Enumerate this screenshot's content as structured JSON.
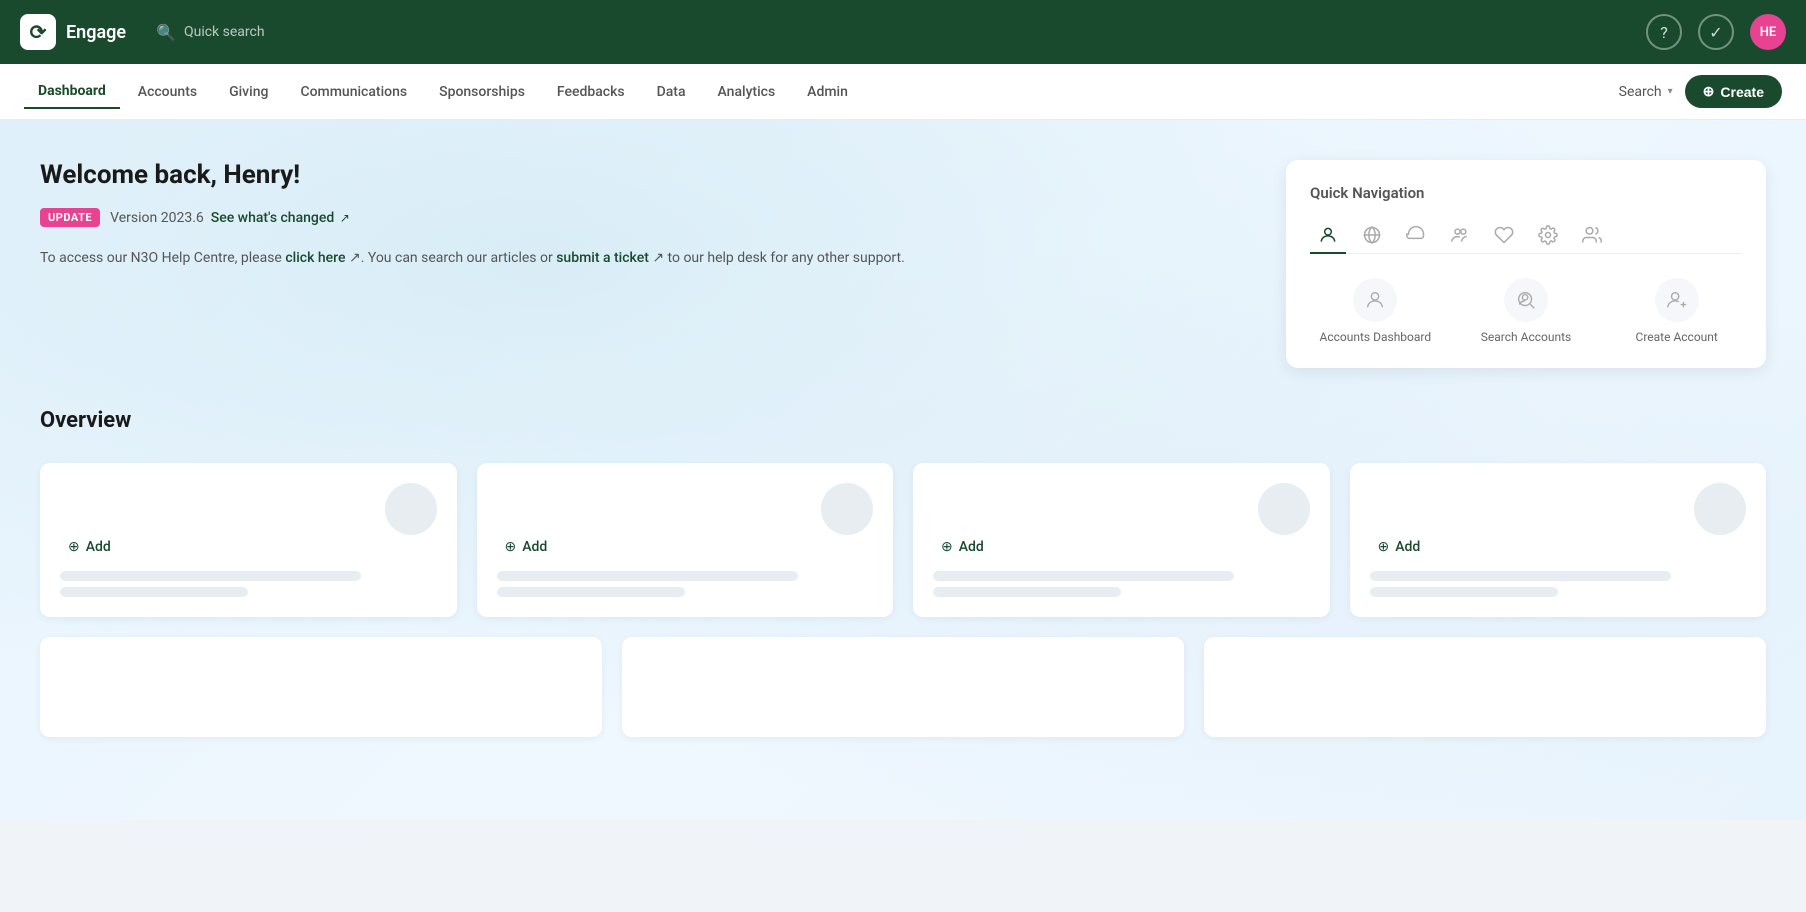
{
  "app": {
    "name": "Engage",
    "logo_initials": "~"
  },
  "topbar": {
    "quick_search": "Quick search",
    "help_label": "?",
    "tasks_label": "✓",
    "avatar_initials": "HE"
  },
  "mainnav": {
    "items": [
      {
        "id": "dashboard",
        "label": "Dashboard",
        "active": true
      },
      {
        "id": "accounts",
        "label": "Accounts",
        "active": false
      },
      {
        "id": "giving",
        "label": "Giving",
        "active": false
      },
      {
        "id": "communications",
        "label": "Communications",
        "active": false
      },
      {
        "id": "sponsorships",
        "label": "Sponsorships",
        "active": false
      },
      {
        "id": "feedbacks",
        "label": "Feedbacks",
        "active": false
      },
      {
        "id": "data",
        "label": "Data",
        "active": false
      },
      {
        "id": "analytics",
        "label": "Analytics",
        "active": false
      },
      {
        "id": "admin",
        "label": "Admin",
        "active": false
      }
    ],
    "search_label": "Search",
    "create_label": "+ Create"
  },
  "welcome": {
    "title_prefix": "Welcome back, ",
    "title_name": "Henry!",
    "badge_label": "UPDATE",
    "version_text": "Version 2023.6",
    "see_changed": "See what's changed",
    "help_intro": "To access our N3O Help Centre, please",
    "click_here": "click here",
    "help_middle": ". You can search our articles or",
    "submit_ticket": "submit a ticket",
    "help_suffix": "to our help desk for any other support."
  },
  "quick_nav": {
    "title": "Quick Navigation",
    "tabs": [
      {
        "id": "person",
        "icon": "👤",
        "active": true
      },
      {
        "id": "giving",
        "icon": "🌐",
        "active": false
      },
      {
        "id": "support",
        "icon": "🎧",
        "active": false
      },
      {
        "id": "group",
        "icon": "👥",
        "active": false
      },
      {
        "id": "heart",
        "icon": "♡",
        "active": false
      },
      {
        "id": "settings",
        "icon": "⚙",
        "active": false
      },
      {
        "id": "users",
        "icon": "👫",
        "active": false
      }
    ],
    "items": [
      {
        "id": "accounts-dashboard",
        "label": "Accounts Dashboard",
        "icon": "👤"
      },
      {
        "id": "search-accounts",
        "label": "Search Accounts",
        "icon": "🔍"
      },
      {
        "id": "create-account",
        "label": "Create Account",
        "icon": "👤+"
      }
    ]
  },
  "overview": {
    "title": "Overview",
    "cards": [
      {
        "add_label": "Add"
      },
      {
        "add_label": "Add"
      },
      {
        "add_label": "Add"
      },
      {
        "add_label": "Add"
      }
    ]
  }
}
